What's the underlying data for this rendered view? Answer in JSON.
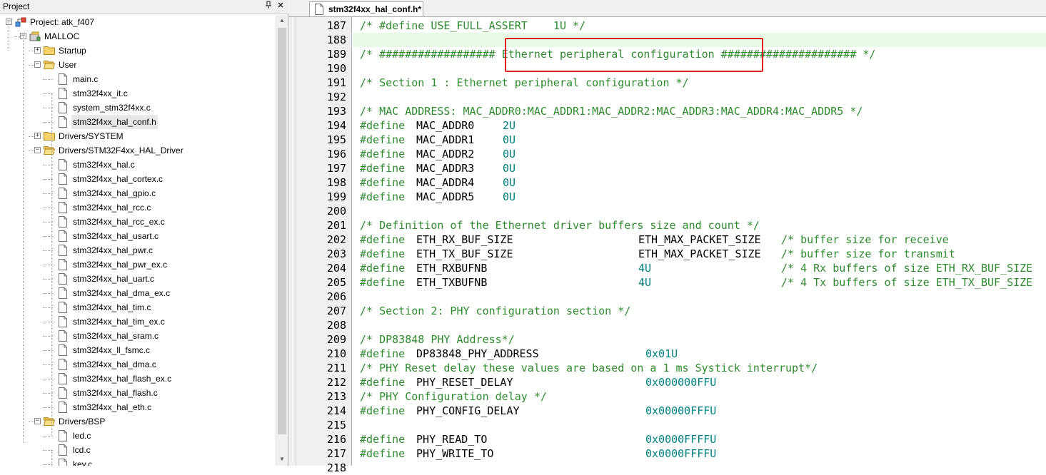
{
  "project_pane": {
    "title": "Project",
    "pin_icon": "pin-icon",
    "close_icon": "close-icon",
    "tree": [
      {
        "label": "Project: atk_f407",
        "icon": "project-icon",
        "expander": "−",
        "type": "project"
      },
      {
        "label": "MALLOC",
        "icon": "target-icon",
        "expander": "−",
        "type": "target"
      },
      {
        "label": "Startup",
        "icon": "folder-icon",
        "expander": "+",
        "type": "folder"
      },
      {
        "label": "User",
        "icon": "folder-open-icon",
        "expander": "−",
        "type": "folder"
      },
      {
        "label": "main.c",
        "icon": "file-icon",
        "type": "file"
      },
      {
        "label": "stm32f4xx_it.c",
        "icon": "file-icon",
        "type": "file"
      },
      {
        "label": "system_stm32f4xx.c",
        "icon": "file-icon",
        "type": "file"
      },
      {
        "label": "stm32f4xx_hal_conf.h",
        "icon": "file-icon",
        "type": "file",
        "selected": true
      },
      {
        "label": "Drivers/SYSTEM",
        "icon": "folder-icon",
        "expander": "+",
        "type": "folder"
      },
      {
        "label": "Drivers/STM32F4xx_HAL_Driver",
        "icon": "folder-open-icon",
        "expander": "−",
        "type": "folder"
      },
      {
        "label": "stm32f4xx_hal.c",
        "icon": "file-icon",
        "type": "file"
      },
      {
        "label": "stm32f4xx_hal_cortex.c",
        "icon": "file-icon",
        "type": "file"
      },
      {
        "label": "stm32f4xx_hal_gpio.c",
        "icon": "file-icon",
        "type": "file"
      },
      {
        "label": "stm32f4xx_hal_rcc.c",
        "icon": "file-icon",
        "type": "file"
      },
      {
        "label": "stm32f4xx_hal_rcc_ex.c",
        "icon": "file-icon",
        "type": "file"
      },
      {
        "label": "stm32f4xx_hal_usart.c",
        "icon": "file-icon",
        "type": "file"
      },
      {
        "label": "stm32f4xx_hal_pwr.c",
        "icon": "file-icon",
        "type": "file"
      },
      {
        "label": "stm32f4xx_hal_pwr_ex.c",
        "icon": "file-icon",
        "type": "file"
      },
      {
        "label": "stm32f4xx_hal_uart.c",
        "icon": "file-icon",
        "type": "file"
      },
      {
        "label": "stm32f4xx_hal_dma_ex.c",
        "icon": "file-icon",
        "type": "file"
      },
      {
        "label": "stm32f4xx_hal_tim.c",
        "icon": "file-icon",
        "type": "file"
      },
      {
        "label": "stm32f4xx_hal_tim_ex.c",
        "icon": "file-icon",
        "type": "file"
      },
      {
        "label": "stm32f4xx_hal_sram.c",
        "icon": "file-icon",
        "type": "file"
      },
      {
        "label": "stm32f4xx_ll_fsmc.c",
        "icon": "file-icon",
        "type": "file"
      },
      {
        "label": "stm32f4xx_hal_dma.c",
        "icon": "file-icon",
        "type": "file"
      },
      {
        "label": "stm32f4xx_hal_flash_ex.c",
        "icon": "file-icon",
        "type": "file"
      },
      {
        "label": "stm32f4xx_hal_flash.c",
        "icon": "file-icon",
        "type": "file"
      },
      {
        "label": "stm32f4xx_hal_eth.c",
        "icon": "file-icon",
        "type": "file"
      },
      {
        "label": "Drivers/BSP",
        "icon": "folder-open-icon",
        "expander": "−",
        "type": "folder"
      },
      {
        "label": "led.c",
        "icon": "file-icon",
        "type": "file"
      },
      {
        "label": "lcd.c",
        "icon": "file-icon",
        "type": "file"
      },
      {
        "label": "key.c",
        "icon": "file-icon",
        "type": "file"
      }
    ]
  },
  "editor": {
    "tab_label": "stm32f4xx_hal_conf.h*",
    "tab_icon": "file-icon",
    "current_line": 188,
    "highlighted_text": "Ethernet peripheral configuration",
    "colors": {
      "comment": "#2e8b2e",
      "number": "#008080",
      "identifier": "#000000",
      "highlight_box": "#e02020",
      "current_line_bg": "#e6fae6"
    },
    "lines": [
      {
        "n": "187",
        "segs": [
          {
            "t": "/* #define USE_FULL_ASSERT    1U */",
            "c": "comment"
          }
        ]
      },
      {
        "n": "188",
        "segs": []
      },
      {
        "n": "189",
        "segs": [
          {
            "t": "/* ################## Ethernet peripheral configuration ##################### */",
            "c": "comment"
          }
        ]
      },
      {
        "n": "190",
        "segs": []
      },
      {
        "n": "191",
        "segs": [
          {
            "t": "/* Section 1 : Ethernet peripheral configuration */",
            "c": "comment"
          }
        ]
      },
      {
        "n": "192",
        "segs": []
      },
      {
        "n": "193",
        "segs": [
          {
            "t": "/* MAC ADDRESS: MAC_ADDR0:MAC_ADDR1:MAC_ADDR2:MAC_ADDR3:MAC_ADDR4:MAC_ADDR5 */",
            "c": "comment"
          }
        ]
      },
      {
        "n": "194",
        "segs": [
          {
            "t": "#define",
            "c": "pp"
          },
          {
            "t": " MAC_ADDR0",
            "c": "id"
          },
          {
            "t": "2U",
            "c": "num",
            "col": 20
          }
        ]
      },
      {
        "n": "195",
        "segs": [
          {
            "t": "#define",
            "c": "pp"
          },
          {
            "t": " MAC_ADDR1",
            "c": "id"
          },
          {
            "t": "0U",
            "c": "num",
            "col": 20
          }
        ]
      },
      {
        "n": "196",
        "segs": [
          {
            "t": "#define",
            "c": "pp"
          },
          {
            "t": " MAC_ADDR2",
            "c": "id"
          },
          {
            "t": "0U",
            "c": "num",
            "col": 20
          }
        ]
      },
      {
        "n": "197",
        "segs": [
          {
            "t": "#define",
            "c": "pp"
          },
          {
            "t": " MAC_ADDR3",
            "c": "id"
          },
          {
            "t": "0U",
            "c": "num",
            "col": 20
          }
        ]
      },
      {
        "n": "198",
        "segs": [
          {
            "t": "#define",
            "c": "pp"
          },
          {
            "t": " MAC_ADDR4",
            "c": "id"
          },
          {
            "t": "0U",
            "c": "num",
            "col": 20
          }
        ]
      },
      {
        "n": "199",
        "segs": [
          {
            "t": "#define",
            "c": "pp"
          },
          {
            "t": " MAC_ADDR5",
            "c": "id"
          },
          {
            "t": "0U",
            "c": "num",
            "col": 20
          }
        ]
      },
      {
        "n": "200",
        "segs": []
      },
      {
        "n": "201",
        "segs": [
          {
            "t": "/* Definition of the Ethernet driver buffers size and count */",
            "c": "comment"
          }
        ]
      },
      {
        "n": "202",
        "segs": [
          {
            "t": "#define",
            "c": "pp"
          },
          {
            "t": " ETH_RX_BUF_SIZE",
            "c": "id"
          },
          {
            "t": "ETH_MAX_PACKET_SIZE",
            "c": "id",
            "col": 39
          },
          {
            "t": "/* buffer size for receive",
            "c": "comment",
            "col": 59
          }
        ]
      },
      {
        "n": "203",
        "segs": [
          {
            "t": "#define",
            "c": "pp"
          },
          {
            "t": " ETH_TX_BUF_SIZE",
            "c": "id"
          },
          {
            "t": "ETH_MAX_PACKET_SIZE",
            "c": "id",
            "col": 39
          },
          {
            "t": "/* buffer size for transmit",
            "c": "comment",
            "col": 59
          }
        ]
      },
      {
        "n": "204",
        "segs": [
          {
            "t": "#define",
            "c": "pp"
          },
          {
            "t": " ETH_RXBUFNB",
            "c": "id"
          },
          {
            "t": "4U",
            "c": "num",
            "col": 39
          },
          {
            "t": "/* 4 Rx buffers of size ETH_RX_BUF_SIZE",
            "c": "comment",
            "col": 59
          }
        ]
      },
      {
        "n": "205",
        "segs": [
          {
            "t": "#define",
            "c": "pp"
          },
          {
            "t": " ETH_TXBUFNB",
            "c": "id"
          },
          {
            "t": "4U",
            "c": "num",
            "col": 39
          },
          {
            "t": "/* 4 Tx buffers of size ETH_TX_BUF_SIZE",
            "c": "comment",
            "col": 59
          }
        ]
      },
      {
        "n": "206",
        "segs": []
      },
      {
        "n": "207",
        "segs": [
          {
            "t": "/* Section 2: PHY configuration section */",
            "c": "comment"
          }
        ]
      },
      {
        "n": "208",
        "segs": []
      },
      {
        "n": "209",
        "segs": [
          {
            "t": "/* DP83848 PHY Address*/",
            "c": "comment"
          }
        ]
      },
      {
        "n": "210",
        "segs": [
          {
            "t": "#define",
            "c": "pp"
          },
          {
            "t": " DP83848_PHY_ADDRESS",
            "c": "id"
          },
          {
            "t": "0x01U",
            "c": "num",
            "col": 40
          }
        ]
      },
      {
        "n": "211",
        "segs": [
          {
            "t": "/* PHY Reset delay these values are based on a 1 ms Systick interrupt*/",
            "c": "comment"
          }
        ]
      },
      {
        "n": "212",
        "segs": [
          {
            "t": "#define",
            "c": "pp"
          },
          {
            "t": " PHY_RESET_DELAY",
            "c": "id"
          },
          {
            "t": "0x000000FFU",
            "c": "num",
            "col": 40
          }
        ]
      },
      {
        "n": "213",
        "segs": [
          {
            "t": "/* PHY Configuration delay */",
            "c": "comment"
          }
        ]
      },
      {
        "n": "214",
        "segs": [
          {
            "t": "#define",
            "c": "pp"
          },
          {
            "t": " PHY_CONFIG_DELAY",
            "c": "id"
          },
          {
            "t": "0x00000FFFU",
            "c": "num",
            "col": 40
          }
        ]
      },
      {
        "n": "215",
        "segs": []
      },
      {
        "n": "216",
        "segs": [
          {
            "t": "#define",
            "c": "pp"
          },
          {
            "t": " PHY_READ_TO",
            "c": "id"
          },
          {
            "t": "0x0000FFFFU",
            "c": "num",
            "col": 40
          }
        ]
      },
      {
        "n": "217",
        "segs": [
          {
            "t": "#define",
            "c": "pp"
          },
          {
            "t": " PHY_WRITE_TO",
            "c": "id"
          },
          {
            "t": "0x0000FFFFU",
            "c": "num",
            "col": 40
          }
        ]
      },
      {
        "n": "218",
        "segs": []
      }
    ]
  }
}
